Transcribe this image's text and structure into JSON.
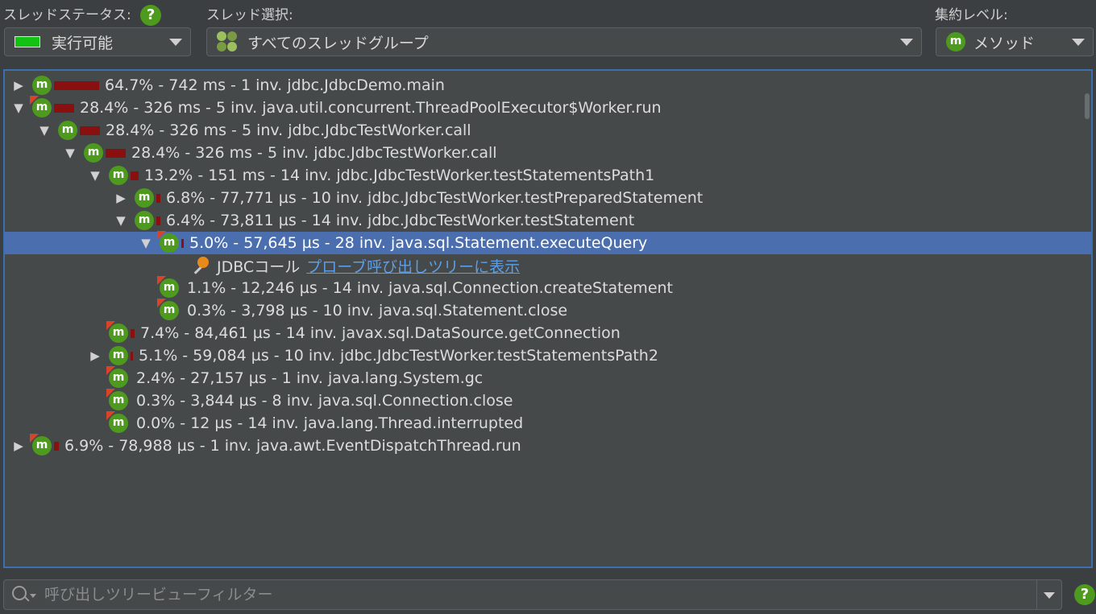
{
  "toolbar": {
    "thread_status_label": "スレッドステータス:",
    "thread_status_value": "実行可能",
    "thread_select_label": "スレッド選択:",
    "thread_select_value": "すべてのスレッドグループ",
    "aggregation_label": "集約レベル:",
    "aggregation_value": "メソッド",
    "help": "?"
  },
  "tree_rows": [
    {
      "toggle": "▶",
      "flag": false,
      "bar": 56,
      "text": "64.7% - 742 ms - 1 inv. jdbc.JdbcDemo.main"
    },
    {
      "toggle": "▼",
      "flag": true,
      "bar": 25,
      "text": "28.4% - 326 ms - 5 inv. java.util.concurrent.ThreadPoolExecutor$Worker.run"
    },
    {
      "toggle": "▼",
      "flag": false,
      "bar": 25,
      "text": "28.4% - 326 ms - 5 inv. jdbc.JdbcTestWorker.call"
    },
    {
      "toggle": "▼",
      "flag": false,
      "bar": 25,
      "text": "28.4% - 326 ms - 5 inv. jdbc.JdbcTestWorker.call"
    },
    {
      "toggle": "▼",
      "flag": false,
      "bar": 10,
      "text": "13.2% - 151 ms - 14 inv. jdbc.JdbcTestWorker.testStatementsPath1"
    },
    {
      "toggle": "▶",
      "flag": false,
      "bar": 5,
      "text": "6.8% - 77,771 µs - 10 inv. jdbc.JdbcTestWorker.testPreparedStatement"
    },
    {
      "toggle": "▼",
      "flag": false,
      "bar": 5,
      "text": "6.4% - 73,811 µs - 14 inv. jdbc.JdbcTestWorker.testStatement"
    },
    {
      "toggle": "▼",
      "flag": true,
      "bar": 3,
      "text": "5.0% - 57,645 µs - 28 inv. java.sql.Statement.executeQuery",
      "selected": true
    },
    {
      "type": "probe",
      "text": "JDBCコール",
      "link": "プローブ呼び出しツリーに表示"
    },
    {
      "toggle": "",
      "flag": true,
      "bar": 0,
      "text": "1.1% - 12,246 µs - 14 inv. java.sql.Connection.createStatement"
    },
    {
      "toggle": "",
      "flag": true,
      "bar": 0,
      "text": "0.3% - 3,798 µs - 10 inv. java.sql.Statement.close"
    },
    {
      "toggle": "",
      "flag": true,
      "bar": 5,
      "text": "7.4% - 84,461 µs - 14 inv. javax.sql.DataSource.getConnection"
    },
    {
      "toggle": "▶",
      "flag": false,
      "bar": 3,
      "text": "5.1% - 59,084 µs - 10 inv. jdbc.JdbcTestWorker.testStatementsPath2"
    },
    {
      "toggle": "",
      "flag": true,
      "bar": 0,
      "text": "2.4% - 27,157 µs - 1 inv. java.lang.System.gc"
    },
    {
      "toggle": "",
      "flag": true,
      "bar": 0,
      "text": "0.3% - 3,844 µs - 8 inv. java.sql.Connection.close"
    },
    {
      "toggle": "",
      "flag": true,
      "bar": 0,
      "text": "0.0% - 12 µs - 14 inv. java.lang.Thread.interrupted"
    },
    {
      "toggle": "▶",
      "flag": true,
      "bar": 6,
      "text": "6.9% - 78,988 µs - 1 inv. java.awt.EventDispatchThread.run"
    }
  ],
  "filter": {
    "placeholder": "呼び出しツリービューフィルター"
  },
  "colors": {
    "selection": "#4b6eaf",
    "bar": "#8a0f0f",
    "badge": "#4e9a1f",
    "link": "#5a9eea"
  }
}
